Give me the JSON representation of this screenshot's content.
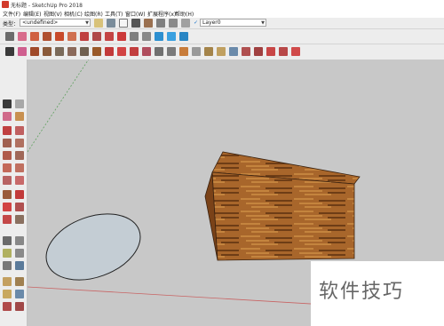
{
  "window": {
    "title": "无标题 - SketchUp Pro 2018"
  },
  "menu": [
    {
      "label": "文件(F)"
    },
    {
      "label": "编辑(E)"
    },
    {
      "label": "视图(V)"
    },
    {
      "label": "相机(C)"
    },
    {
      "label": "绘图(R)"
    },
    {
      "label": "工具(T)"
    },
    {
      "label": "窗口(W)"
    },
    {
      "label": "扩展程序(x)"
    },
    {
      "label": "帮助(H)"
    }
  ],
  "toolbar": {
    "style_label": "类型：",
    "style_value": "<undefined>",
    "layer_check": "✓",
    "layer_value": "Layer0"
  },
  "canvas": {
    "wood_colors": {
      "light": "#c4843e",
      "mid": "#a8662b",
      "dark": "#6e3d16",
      "shadow": "#7a4218"
    },
    "ellipse_fill": "#c4cdd4",
    "axis_green": "#5fa05f",
    "axis_red": "#c86464"
  },
  "watermark": {
    "text": "软件技巧"
  }
}
